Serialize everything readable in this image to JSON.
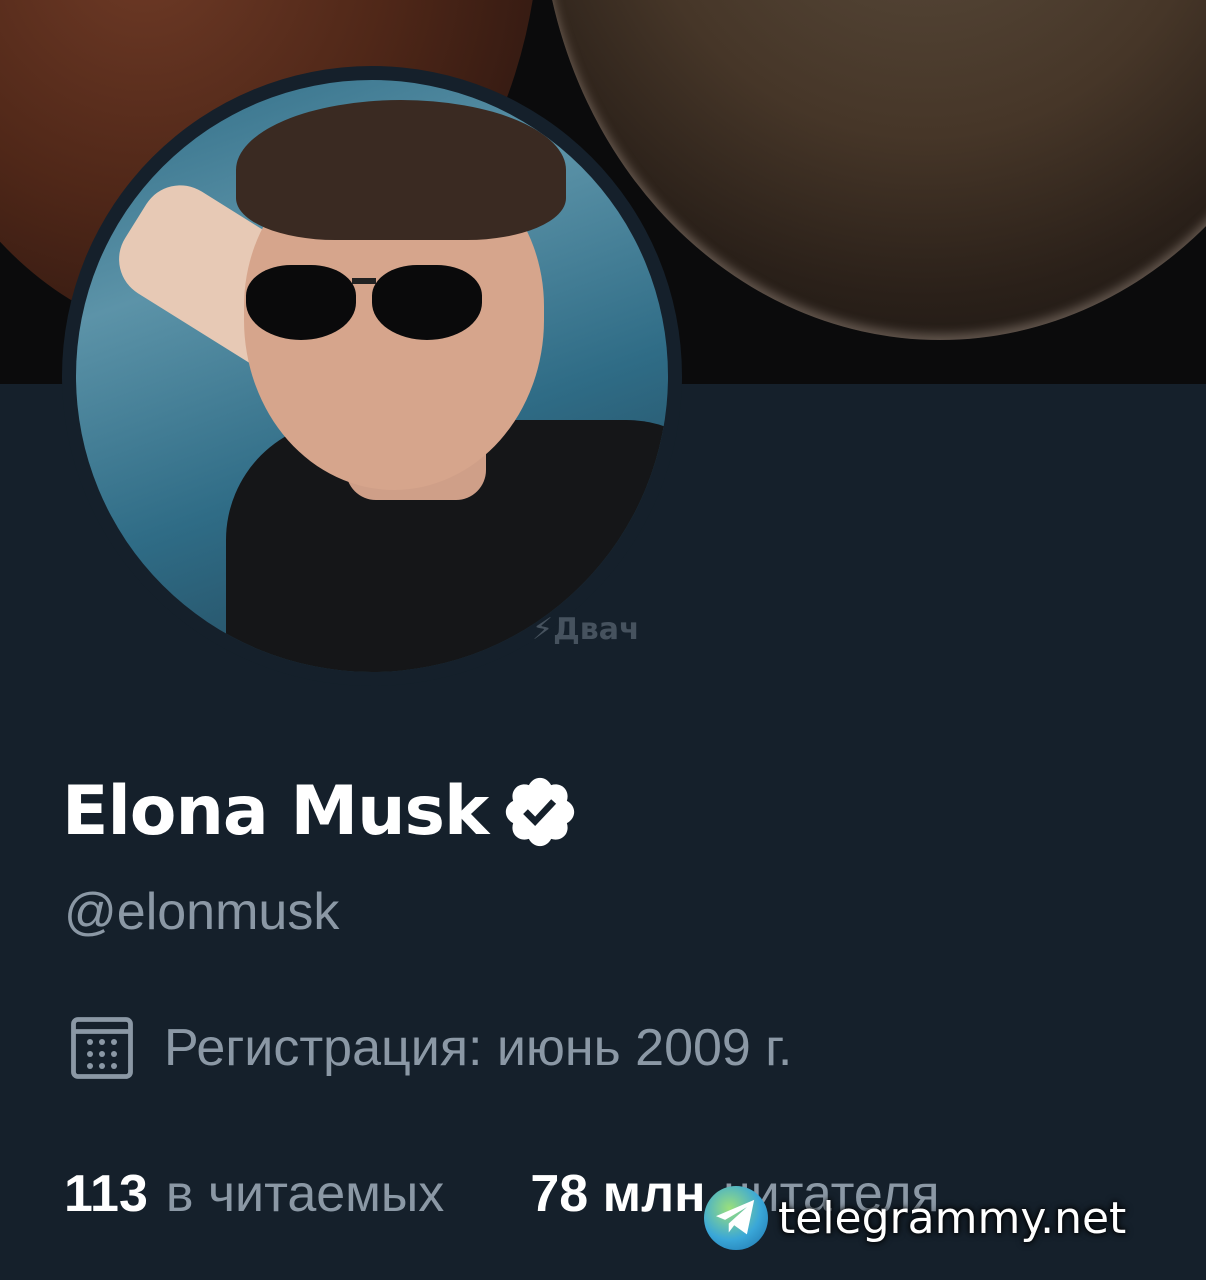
{
  "profile": {
    "display_name": "Elona Musk",
    "handle": "@elonmusk",
    "verified": true,
    "joined": "Регистрация: июнь 2009 г.",
    "stats": [
      {
        "count": "113",
        "label": "в читаемых"
      },
      {
        "count": "78 млн",
        "label": "читателя"
      }
    ]
  },
  "watermarks": {
    "dvach": "Двач",
    "site": "telegrammy.net"
  },
  "icons": {
    "verified": "verified-badge-icon",
    "calendar": "calendar-icon",
    "telegram": "telegram-globe-icon"
  },
  "colors": {
    "background": "#15202b",
    "text_primary": "#ffffff",
    "text_secondary": "#8b98a5"
  }
}
